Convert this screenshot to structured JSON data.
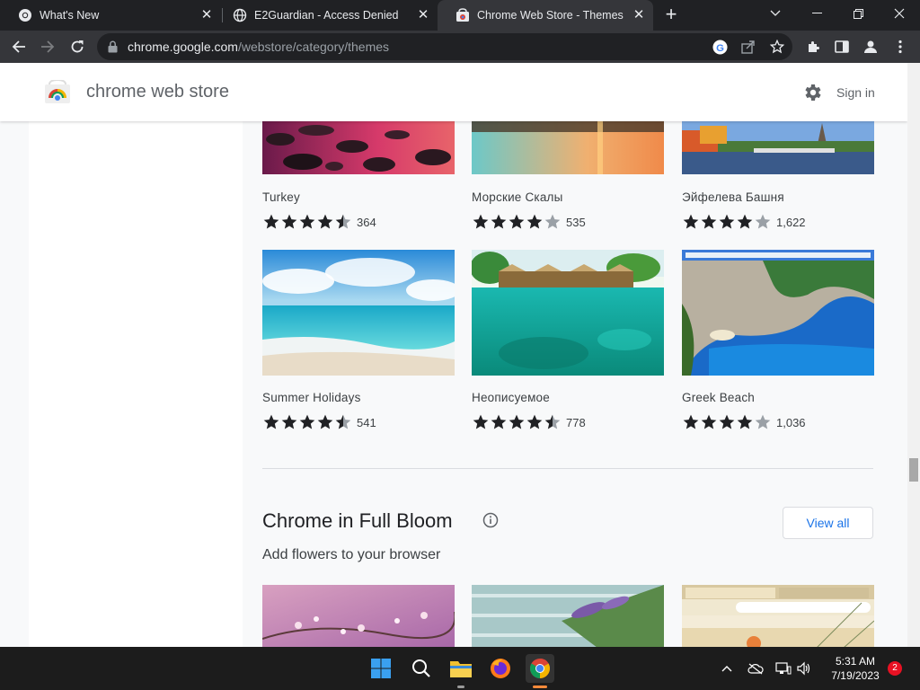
{
  "tabs": [
    {
      "title": "What's New",
      "close": "✕"
    },
    {
      "title": "E2Guardian - Access Denied",
      "close": "✕"
    },
    {
      "title": "Chrome Web Store - Themes",
      "close": "✕"
    }
  ],
  "new_tab": "+",
  "address": {
    "host": "chrome.google.com",
    "path": "/webstore/category/themes"
  },
  "store": {
    "title": "chrome web store",
    "sign_in": "Sign in"
  },
  "themes_row1": [
    {
      "name": "Turkey",
      "rating": 4.5,
      "count": "364"
    },
    {
      "name": "Морские Скалы",
      "rating": 4,
      "count": "535"
    },
    {
      "name": "Эйфелева Башня",
      "rating": 4,
      "count": "1,622"
    }
  ],
  "themes_row2": [
    {
      "name": "Summer Holidays",
      "rating": 4.5,
      "count": "541"
    },
    {
      "name": "Неописуемое",
      "rating": 4.5,
      "count": "778"
    },
    {
      "name": "Greek Beach",
      "rating": 4,
      "count": "1,036"
    }
  ],
  "section": {
    "title": "Chrome in Full Bloom",
    "subtitle": "Add flowers to your browser",
    "view_all": "View all"
  },
  "taskbar": {
    "time": "5:31 AM",
    "date": "7/19/2023",
    "notifications": "2"
  },
  "colors": {
    "accent_blue": "#1a73e8",
    "star": "#202124",
    "star_empty": "#9aa0a6",
    "tab_bar": "#202124",
    "toolbar": "#35363a"
  }
}
